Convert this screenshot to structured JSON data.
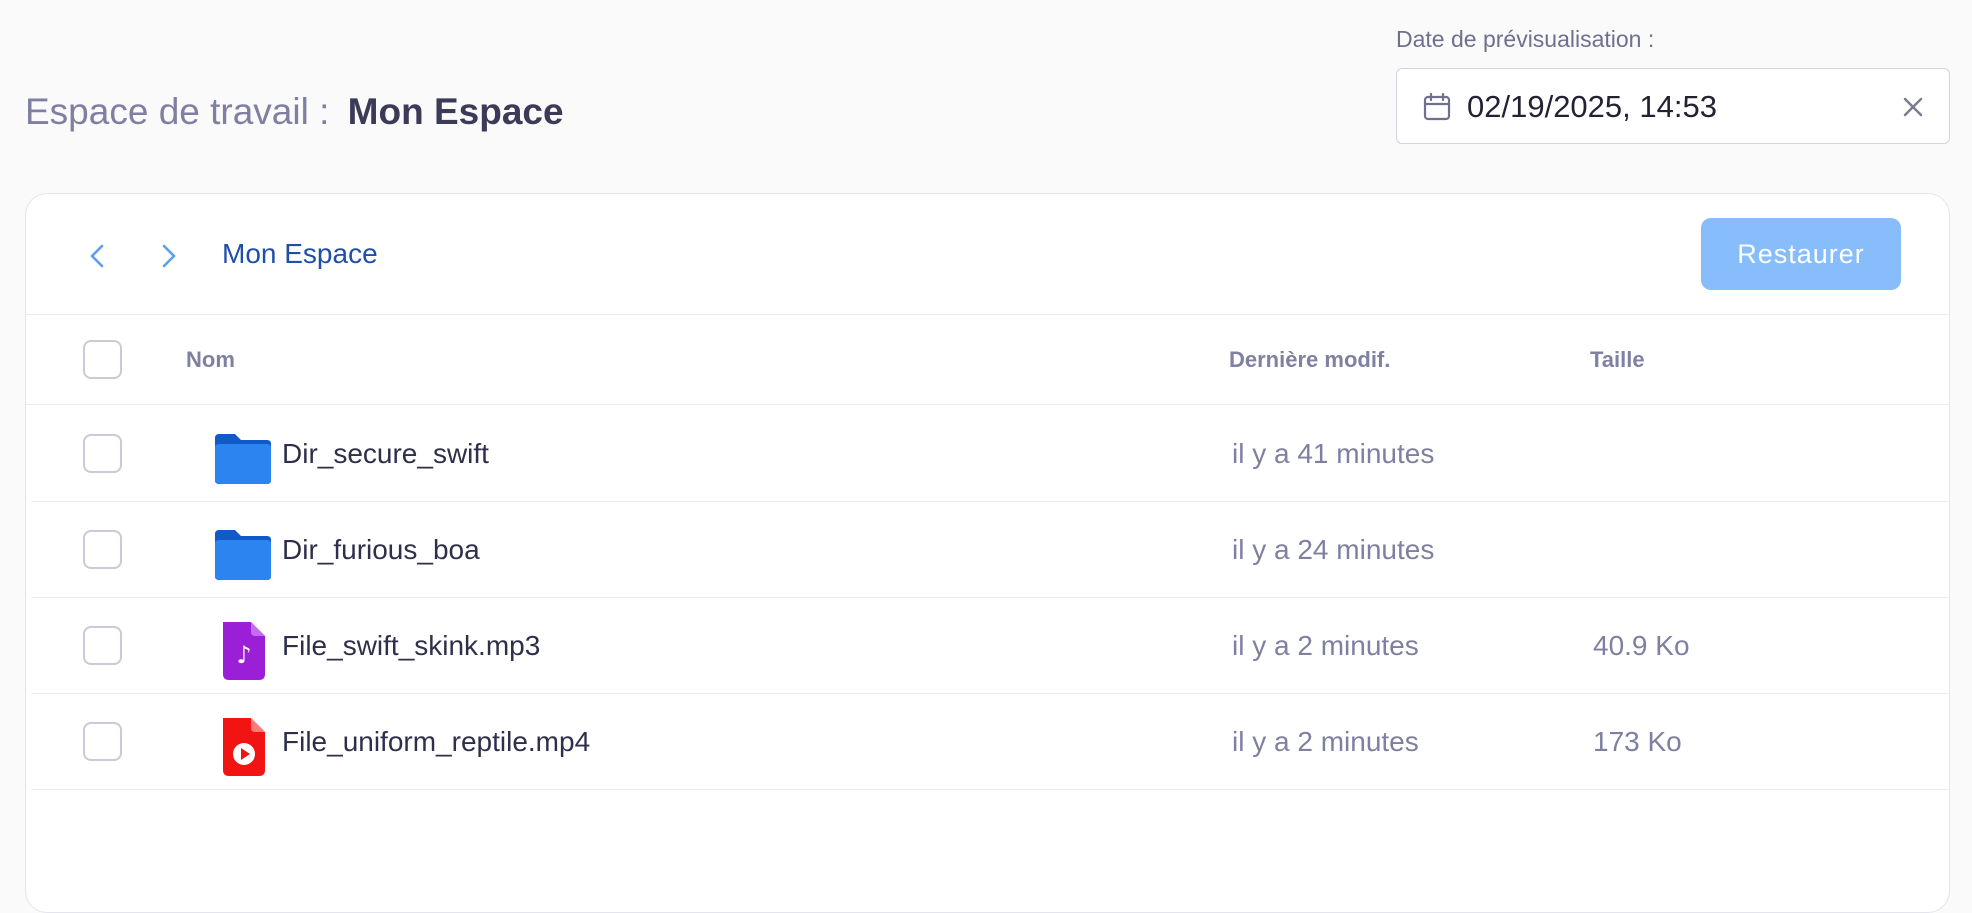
{
  "workspace": {
    "label": "Espace de travail :",
    "name": "Mon Espace"
  },
  "preview_date": {
    "label": "Date de prévisualisation :",
    "value": "02/19/2025, 14:53",
    "calendar_icon": "calendar-icon",
    "clear_icon": "close-icon"
  },
  "toolbar": {
    "back_icon": "chevron-left-icon",
    "forward_icon": "chevron-right-icon",
    "breadcrumb": "Mon Espace",
    "restore_label": "Restaurer"
  },
  "table": {
    "columns": {
      "name": "Nom",
      "modified": "Dernière modif.",
      "size": "Taille"
    },
    "rows": [
      {
        "name": "Dir_secure_swift",
        "modified": "il y a 41 minutes",
        "size": "",
        "icon": "folder-icon"
      },
      {
        "name": "Dir_furious_boa",
        "modified": "il y a 24 minutes",
        "size": "",
        "icon": "folder-icon"
      },
      {
        "name": "File_swift_skink.mp3",
        "modified": "il y a 2 minutes",
        "size": "40.9 Ko",
        "icon": "audio-file-icon"
      },
      {
        "name": "File_uniform_reptile.mp4",
        "modified": "il y a 2 minutes",
        "size": "173 Ko",
        "icon": "video-file-icon"
      }
    ]
  },
  "colors": {
    "accent": "#1f4fa8",
    "restore_button": "#86bdfa",
    "folder": "#1a6fe0",
    "audio_file": "#9b1fd6",
    "video_file": "#f21313"
  }
}
